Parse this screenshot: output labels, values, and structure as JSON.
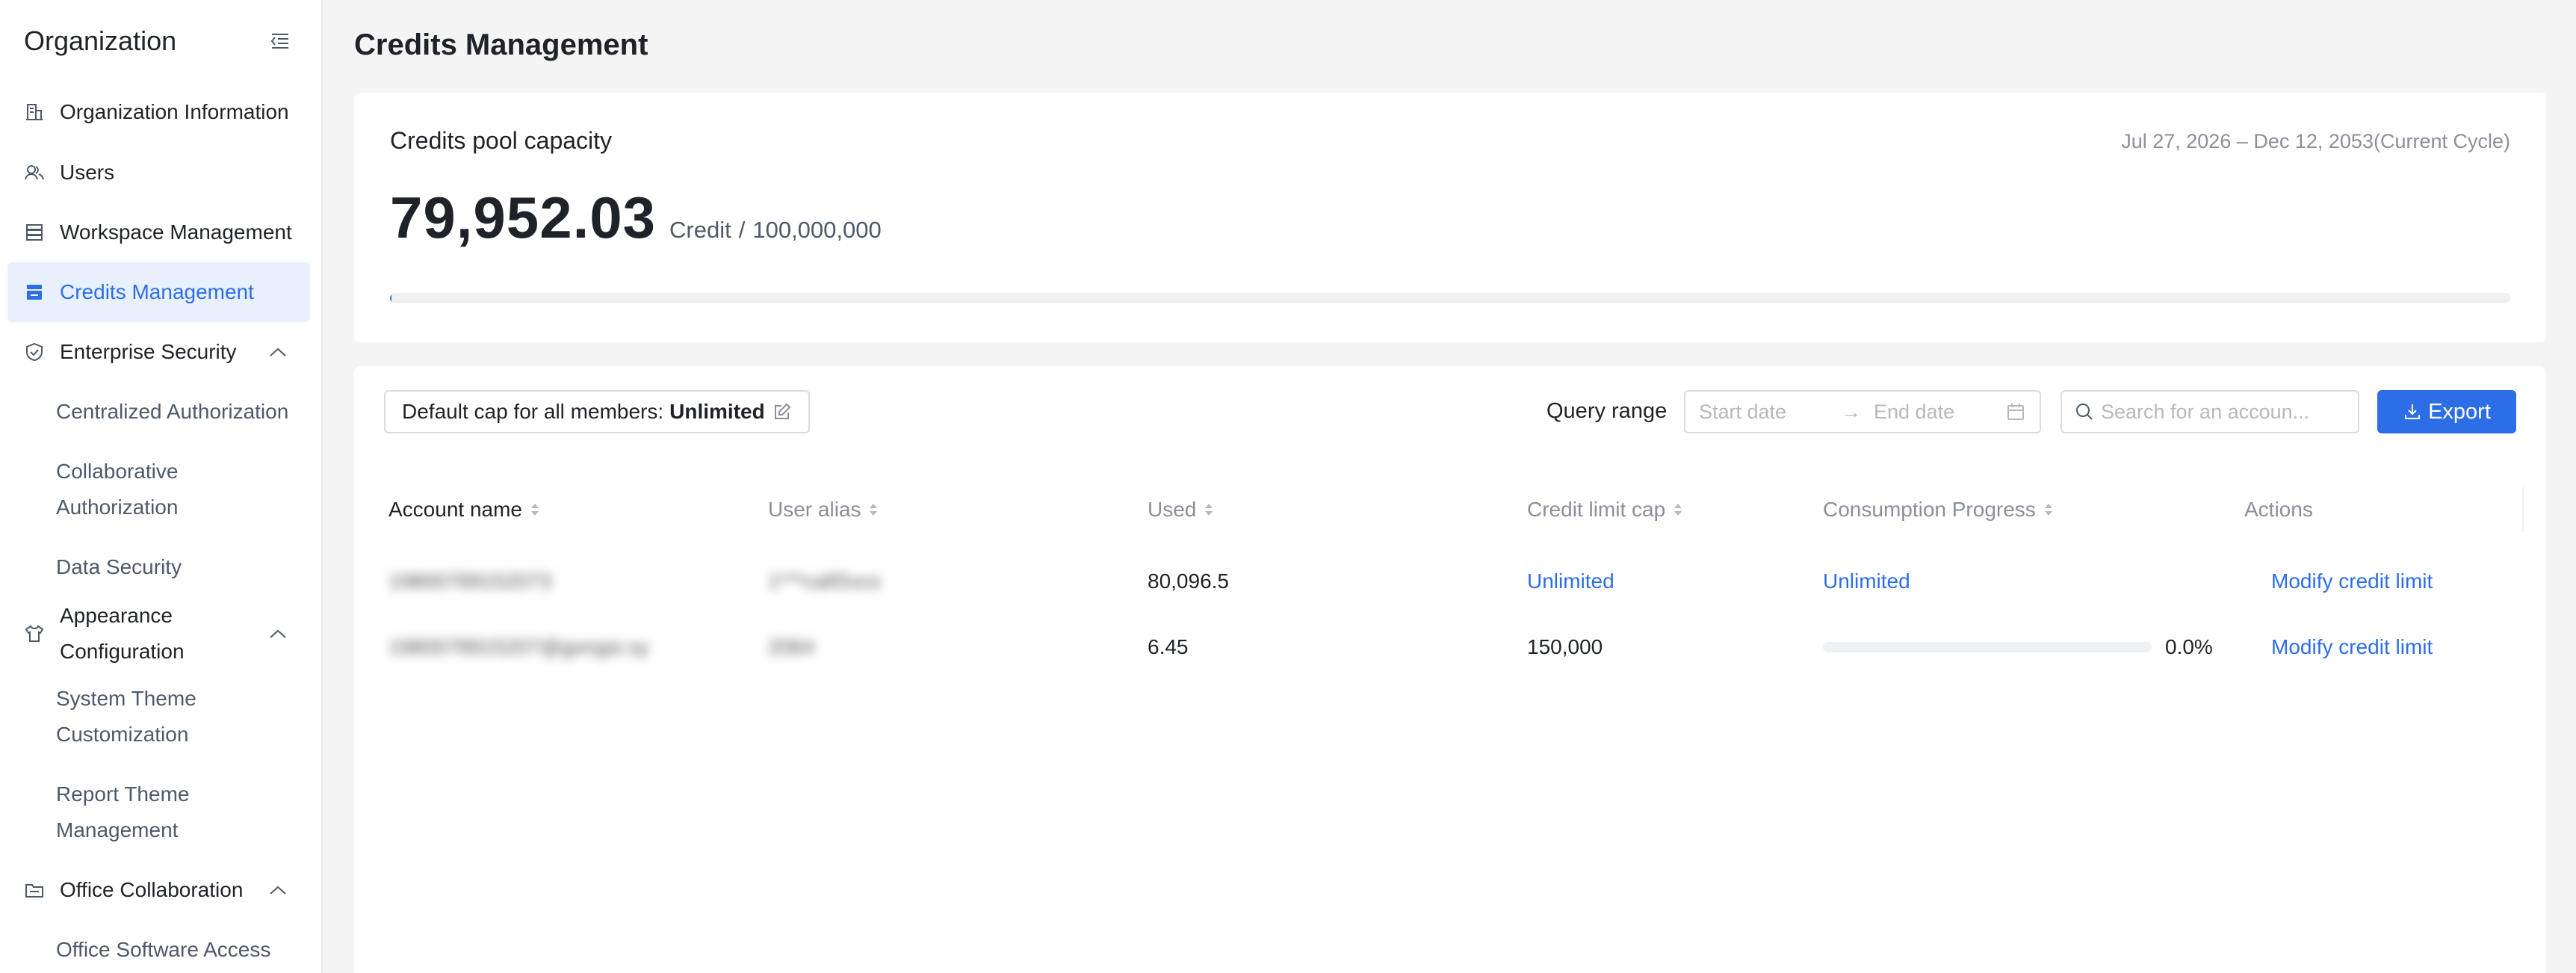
{
  "sidebar": {
    "title": "Organization",
    "items": [
      {
        "label": "Organization Information",
        "icon": "building-icon"
      },
      {
        "label": "Users",
        "icon": "users-icon"
      },
      {
        "label": "Workspace Management",
        "icon": "workspace-icon"
      },
      {
        "label": "Credits Management",
        "icon": "credits-icon",
        "active": true
      },
      {
        "label": "Enterprise Security",
        "icon": "shield-icon",
        "expanded": true
      },
      {
        "label": "Appearance Configuration",
        "icon": "shirt-icon",
        "expanded": true
      },
      {
        "label": "Office Collaboration",
        "icon": "office-icon",
        "expanded": true
      }
    ],
    "sub_items": {
      "enterprise_security": [
        "Centralized Authorization",
        "Collaborative Authorization",
        "Data Security"
      ],
      "appearance": [
        "System Theme Customization",
        "Report Theme Management"
      ],
      "office": [
        "Office Software Access"
      ]
    }
  },
  "page": {
    "title": "Credits Management"
  },
  "pool": {
    "title": "Credits pool capacity",
    "cycle": "Jul 27, 2026 – Dec 12, 2053(Current Cycle)",
    "amount": "79,952.03",
    "unit": "Credit",
    "separator": "/",
    "total": "100,000,000",
    "usage_fraction": 0.0008
  },
  "toolbar": {
    "default_cap_label": "Default cap for all members:",
    "default_cap_value": "Unlimited",
    "query_label": "Query range",
    "start_placeholder": "Start date",
    "range_arrow": "→",
    "end_placeholder": "End date",
    "search_placeholder": "Search for an accoun...",
    "export_label": "Export"
  },
  "table": {
    "columns": [
      "Account name",
      "User alias",
      "Used",
      "Credit limit cap",
      "Consumption Progress",
      "Actions"
    ],
    "rows": [
      {
        "account": "19800789152073",
        "alias": "1***callSvcs",
        "used": "80,096.5",
        "cap": "Unlimited",
        "progress": "Unlimited",
        "action": "Modify credit limit"
      },
      {
        "account": "1980078915207@gongsi.sy",
        "alias": "2064",
        "used": "6.45",
        "cap": "150,000",
        "progress_pct": "0.0%",
        "progress_fraction": 0.0,
        "action": "Modify credit limit"
      }
    ]
  },
  "colors": {
    "accent": "#2d6ee6",
    "active_bg": "#e8f0fd",
    "page_bg": "#f4f4f4"
  }
}
